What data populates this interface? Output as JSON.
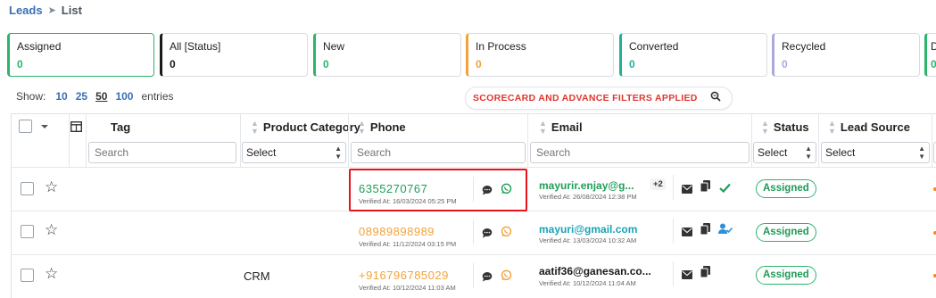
{
  "breadcrumb": {
    "root": "Leads",
    "separator": "➤",
    "current": "List"
  },
  "tiles": [
    {
      "label": "Assigned",
      "count": "0",
      "color": "#2bb56a"
    },
    {
      "label": "All [Status]",
      "count": "0",
      "color": "#1a1a1a"
    },
    {
      "label": "New",
      "count": "0",
      "color": "#2bb56a"
    },
    {
      "label": "In Process",
      "count": "0",
      "color": "#f2a33a"
    },
    {
      "label": "Converted",
      "count": "0",
      "color": "#23b09a"
    },
    {
      "label": "Recycled",
      "count": "0",
      "color": "#a9a9dc"
    },
    {
      "label": "D",
      "count": "0",
      "color": "#2bb56a"
    }
  ],
  "show": {
    "label": "Show:",
    "options": [
      "10",
      "25",
      "50",
      "100"
    ],
    "active": "50",
    "suffix": "entries"
  },
  "filter": {
    "label": "SCORECARD AND ADVANCE FILTERS APPLIED",
    "icon": "search-icon"
  },
  "columns": {
    "tag": "Tag",
    "product_category": "Product Category",
    "phone": "Phone",
    "email": "Email",
    "status": "Status",
    "lead_source": "Lead Source"
  },
  "search_placeholder": "Search",
  "select_label": "Select",
  "rows": [
    {
      "category": "",
      "phone": "6355270767",
      "phone_verified": "Verified At: 16/03/2024 05:25 PM",
      "phone_color": "#1e9e58",
      "email": "mayurir.enjay@g...",
      "email_color": "#1e9e58",
      "email_extra": "+2",
      "email_verified": "Verified At: 26/08/2024 12:38 PM",
      "actions": [
        "mail-icon",
        "copy-icon",
        "check-icon"
      ],
      "status": "Assigned"
    },
    {
      "category": "",
      "phone": "08989898989",
      "phone_verified": "Verified At: 11/12/2024 03:15 PM",
      "phone_color": "#f2a33a",
      "email": "mayuri@gmail.com",
      "email_color": "#1aa3b5",
      "email_extra": "",
      "email_verified": "Verified At: 13/03/2024 10:32 AM",
      "actions": [
        "mail-icon",
        "copy-icon",
        "user-check-icon"
      ],
      "status": "Assigned"
    },
    {
      "category": "CRM",
      "phone": "+916796785029",
      "phone_verified": "Verified At: 10/12/2024 11:03 AM",
      "phone_color": "#f2a33a",
      "email": "aatif36@ganesan.co...",
      "email_color": "#1a1a1a",
      "email_extra": "",
      "email_verified": "Verified At: 10/12/2024 11:04 AM",
      "actions": [
        "mail-icon",
        "copy-icon"
      ],
      "status": "Assigned"
    }
  ]
}
